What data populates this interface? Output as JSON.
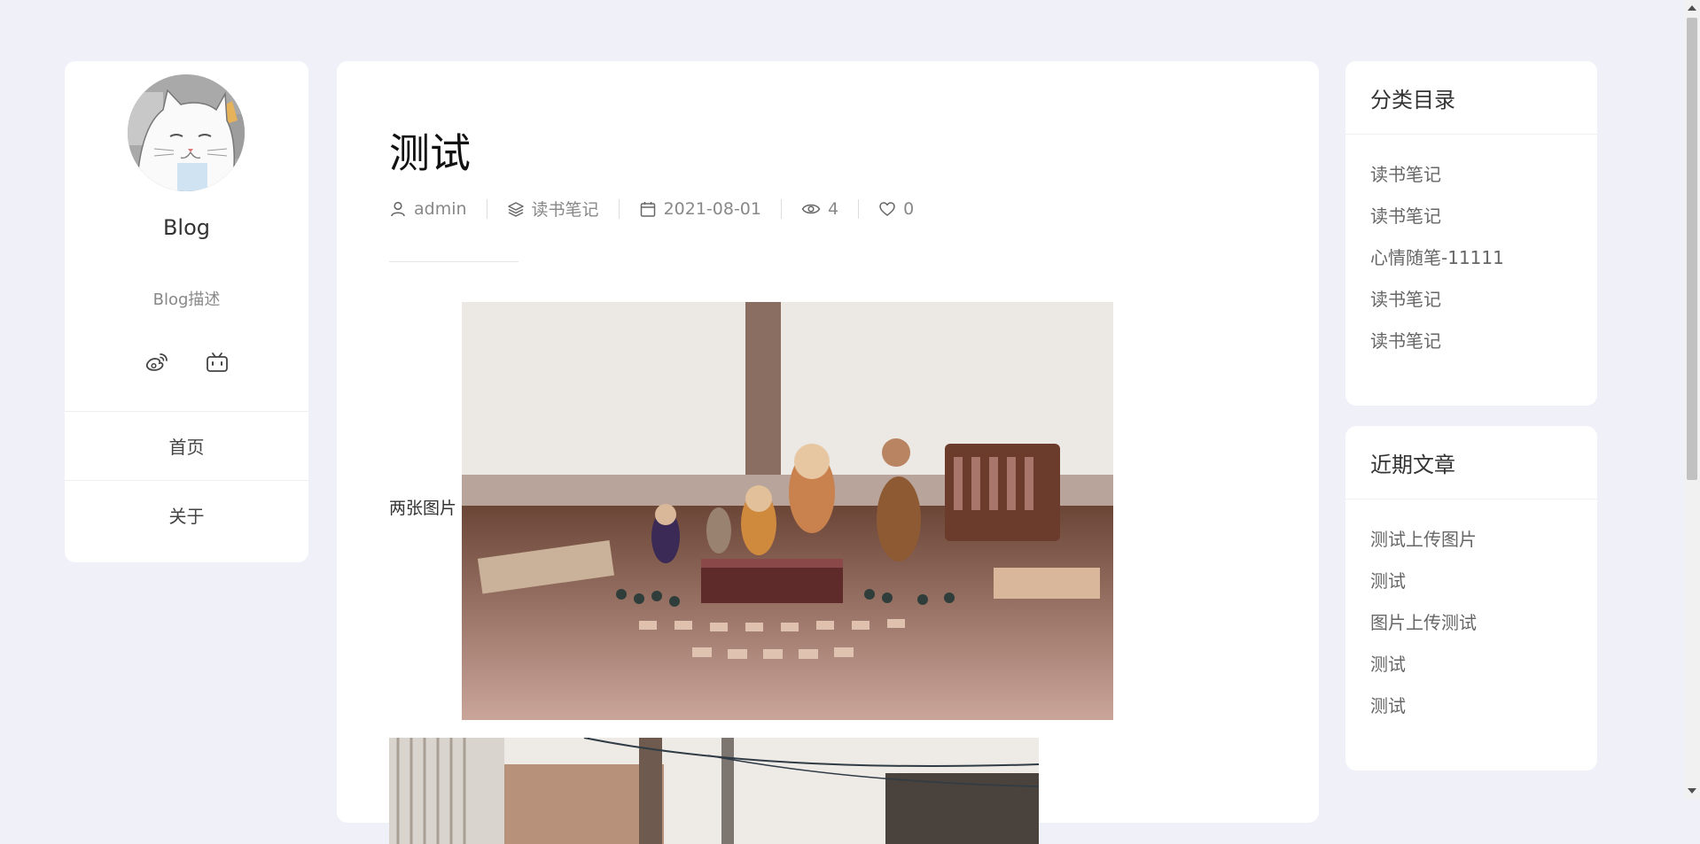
{
  "profile": {
    "site_name": "Blog",
    "site_desc": "Blog描述",
    "socials": [
      {
        "icon": "weibo-icon"
      },
      {
        "icon": "bilibili-icon"
      }
    ],
    "nav": [
      {
        "label": "首页"
      },
      {
        "label": "关于"
      }
    ]
  },
  "post": {
    "title": "测试",
    "meta": {
      "author": "admin",
      "category": "读书笔记",
      "date": "2021-08-01",
      "views": "4",
      "likes": "0"
    },
    "content_text": "两张图片"
  },
  "sidebar": {
    "categories": {
      "title": "分类目录",
      "items": [
        "读书笔记",
        "读书笔记",
        "心情随笔-11111",
        "读书笔记",
        "读书笔记"
      ]
    },
    "recent": {
      "title": "近期文章",
      "items": [
        "测试上传图片",
        "测试",
        "图片上传测试",
        "测试",
        "测试"
      ]
    }
  },
  "colors": {
    "page_bg": "#eff0f8",
    "card_bg": "#ffffff",
    "text_primary": "#333333",
    "text_muted": "#888888"
  }
}
